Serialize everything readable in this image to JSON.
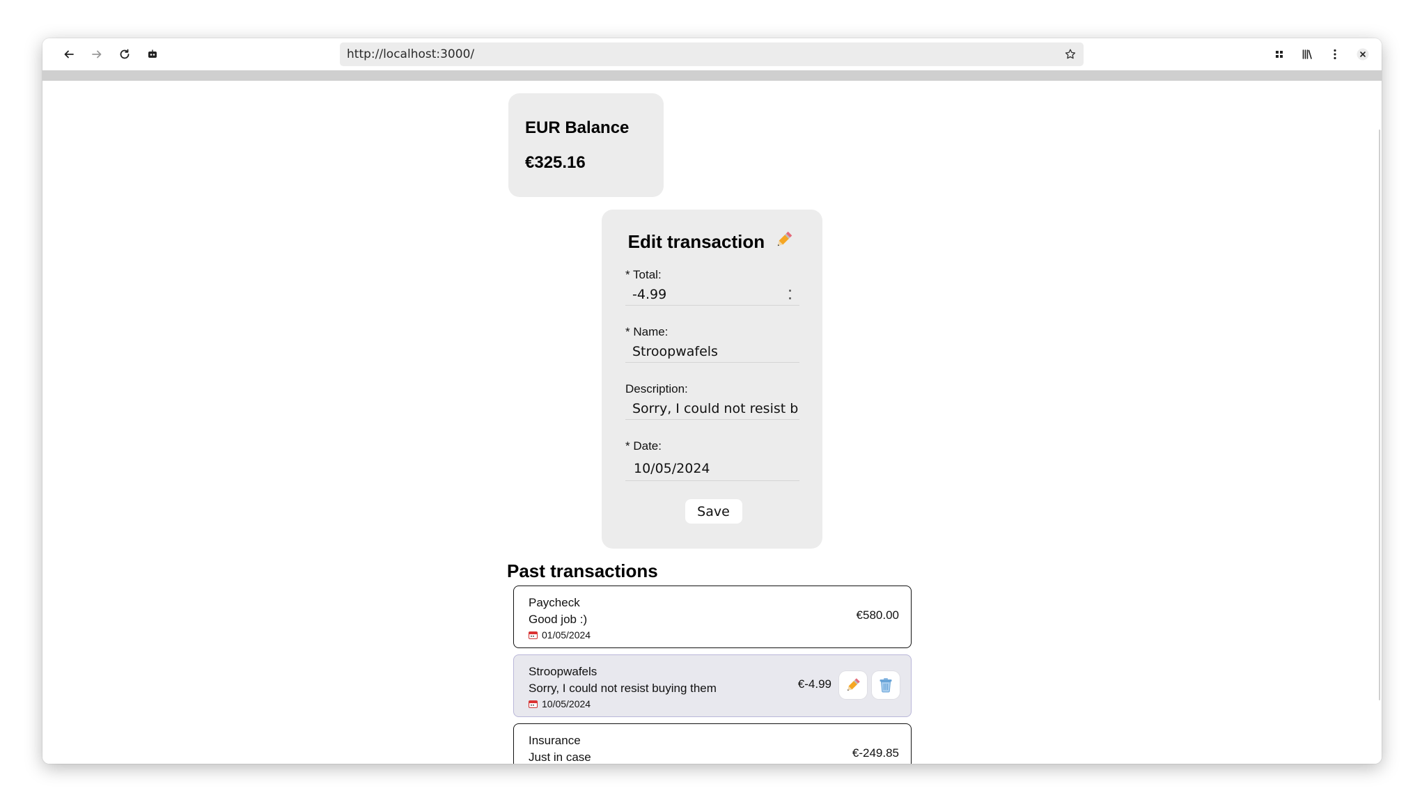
{
  "browser": {
    "url": "http://localhost:3000/"
  },
  "balance": {
    "title": "EUR Balance",
    "value": "€325.16"
  },
  "edit_form": {
    "title": "Edit transaction",
    "total_label": "* Total:",
    "total_value": "-4.99",
    "name_label": "* Name:",
    "name_value": "Stroopwafels",
    "description_label": "Description:",
    "description_value": "Sorry, I could not resist b",
    "date_label": "* Date:",
    "date_value": "10/05/2024",
    "save_label": "Save"
  },
  "past": {
    "title": "Past transactions",
    "items": [
      {
        "name": "Paycheck",
        "description": "Good job :)",
        "date": "01/05/2024",
        "amount": "€580.00"
      },
      {
        "name": "Stroopwafels",
        "description": "Sorry, I could not resist buying them",
        "date": "10/05/2024",
        "amount": "€-4.99"
      },
      {
        "name": "Insurance",
        "description": "Just in case",
        "date": "",
        "amount": "€-249.85"
      }
    ]
  },
  "colors": {
    "card_bg": "#ececec",
    "highlight_bg": "#e8e8ee",
    "highlight_border": "#b9b6d8",
    "pencil": "#f5a623",
    "trash": "#6aa5d8"
  }
}
